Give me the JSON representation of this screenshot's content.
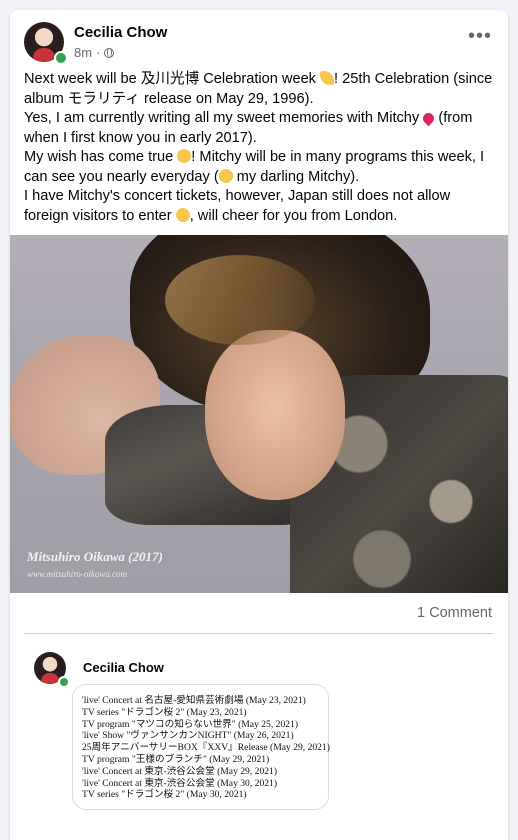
{
  "post": {
    "author": "Cecilia Chow",
    "time": "8m",
    "more_icon": "more-horizontal-icon",
    "privacy_icon": "globe-icon",
    "text": {
      "line1_a": "Next week will be 及川光博 Celebration week ",
      "line1_b": "!  25th Celebration (since album モラリティ release on May 29, 1996).",
      "line2_a": "Yes, I am currently writing all my sweet memories with Mitchy ",
      "line2_b": " (from when I first know you in early 2017).",
      "line3_a": "My wish has come true ",
      "line3_b": "!  Mitchy will be in many programs this week, I can see you nearly everyday (",
      "line3_c": " my darling Mitchy).",
      "line4_a": "I have Mitchy's concert tickets, however, Japan still does not allow foreign visitors to enter ",
      "line4_b": ", will cheer for you from London."
    },
    "photo": {
      "caption": "Mitsuhiro Oikawa  (2017)",
      "watermark": "www.mitsuhiro-oikawa.com"
    },
    "comment_count": "1 Comment"
  },
  "comment": {
    "author": "Cecilia Chow",
    "schedule": [
      "'live' Concert at 名古屋-愛知県芸術劇場  (May 23, 2021)",
      "TV series \"ドラゴン桜 2\"  (May 23, 2021)",
      "TV program \"マツコの知らない世界\"  (May 25, 2021)",
      "'live' Show \"ヴァンサンカンNIGHT\"  (May 26, 2021)",
      "25周年アニバーサリーBOX『XXV』Release  (May 29, 2021)",
      "TV program \"王様のブランチ\"  (May 29, 2021)",
      "'live' Concert at 東京-渋谷公会堂  (May 29, 2021)",
      "'live' Concert at 東京-渋谷公会堂  (May 30, 2021)",
      "TV series \"ドラゴン桜 2\"  (May 30, 2021)"
    ]
  },
  "colors": {
    "online": "#31a24c",
    "secondary_text": "#65676b",
    "background": "#f0f2f5"
  }
}
